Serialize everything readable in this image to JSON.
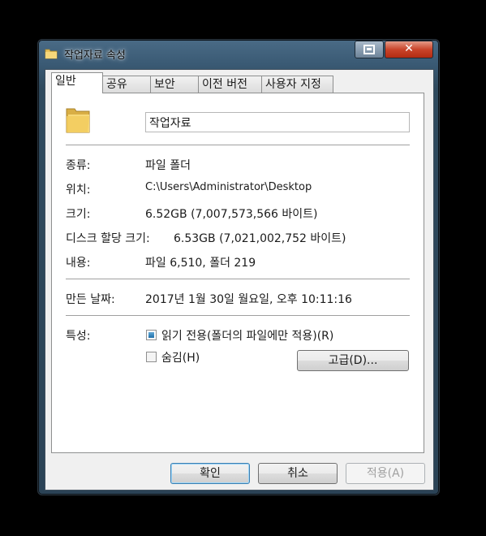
{
  "window": {
    "title": "작업자료 속성"
  },
  "tabs": [
    "일반",
    "공유",
    "보안",
    "이전 버전",
    "사용자 지정"
  ],
  "general": {
    "folder_name": "작업자료",
    "rows": [
      {
        "label": "종류:",
        "value": "파일 폴더"
      },
      {
        "label": "위치:",
        "value": "C:\\Users\\Administrator\\Desktop"
      },
      {
        "label": "크기:",
        "value": "6.52GB (7,007,573,566 바이트)"
      },
      {
        "label": "디스크 할당 크기:",
        "value": "6.53GB (7,021,002,752 바이트)"
      },
      {
        "label": "내용:",
        "value": "파일 6,510, 폴더 219"
      }
    ],
    "created": {
      "label": "만든 날짜:",
      "value": "2017년 1월 30일 월요일, 오후 10:11:16"
    },
    "attributes": {
      "label": "특성:",
      "readonly": "읽기 전용(폴더의 파일에만 적용)(R)",
      "hidden": "숨김(H)",
      "advanced": "고급(D)..."
    }
  },
  "buttons": {
    "ok": "확인",
    "cancel": "취소",
    "apply": "적용(A)"
  },
  "colors": {
    "accent": "#3c7fb1",
    "close": "#c9442a"
  }
}
